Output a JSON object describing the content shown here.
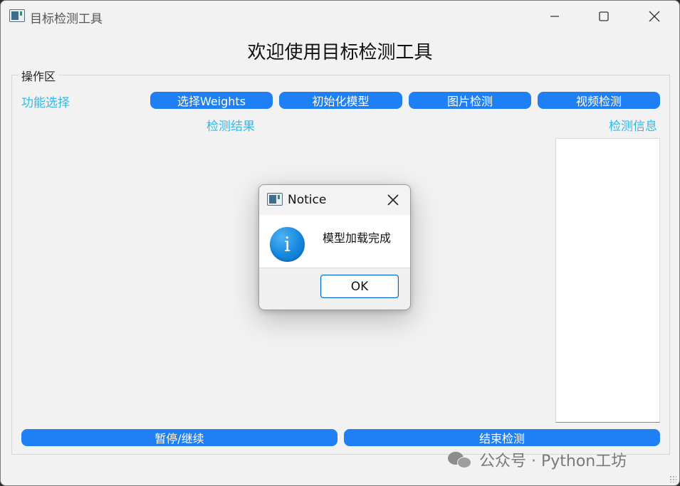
{
  "window": {
    "title": "目标检测工具"
  },
  "main": {
    "heading": "欢迎使用目标检测工具",
    "group_label": "操作区",
    "function_label": "功能选择",
    "result_label": "检测结果",
    "info_label": "检测信息",
    "buttons": {
      "select_weights": "选择Weights",
      "init_model": "初始化模型",
      "image_detect": "图片检测",
      "video_detect": "视频检测",
      "pause_resume": "暂停/继续",
      "stop_detect": "结束检测"
    }
  },
  "dialog": {
    "title": "Notice",
    "message": "模型加载完成",
    "ok_label": "OK",
    "icon": "info-icon"
  },
  "watermark": {
    "text": "公众号 · Python工坊",
    "icon": "wechat-icon"
  },
  "colors": {
    "accent_button": "#1f7ff5",
    "label_cyan": "#35b8e8",
    "window_bg": "#f2f2f2"
  }
}
